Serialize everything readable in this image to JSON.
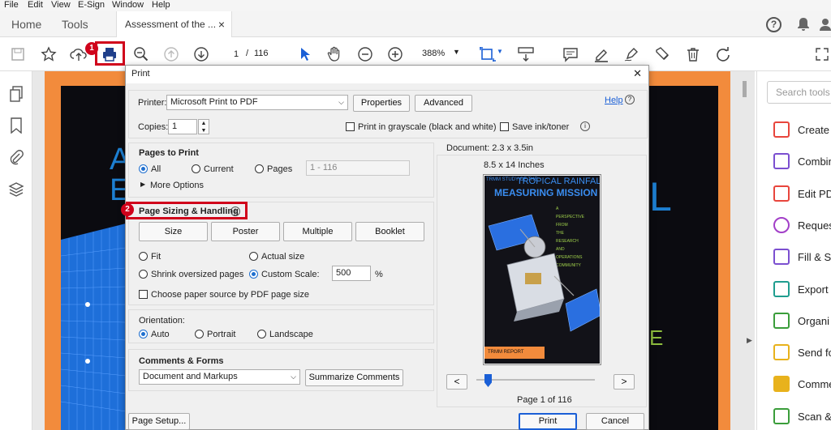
{
  "menubar": {
    "items": [
      "File",
      "Edit",
      "View",
      "E-Sign",
      "Window",
      "Help"
    ]
  },
  "tabs": {
    "home": "Home",
    "tools": "Tools",
    "doc": "Assessment of the ...",
    "close": "×"
  },
  "toolbar": {
    "page_current": "1",
    "page_sep": "/",
    "page_total": "116",
    "zoom": "388%"
  },
  "right_panel": {
    "search_placeholder": "Search tools",
    "items": [
      {
        "label": "Create",
        "color": "#e8453c"
      },
      {
        "label": "Combin",
        "color": "#7b4fd0"
      },
      {
        "label": "Edit PD",
        "color": "#e8453c"
      },
      {
        "label": "Reques",
        "color": "#a23fc8"
      },
      {
        "label": "Fill & S",
        "color": "#7b4fd0"
      },
      {
        "label": "Export",
        "color": "#1f9d8f"
      },
      {
        "label": "Organi",
        "color": "#3a9d3a"
      },
      {
        "label": "Send fo",
        "color": "#e8b21c"
      },
      {
        "label": "Comme",
        "color": "#e8b21c"
      },
      {
        "label": "Scan &",
        "color": "#3a9d3a"
      }
    ]
  },
  "page_bg_text": {
    "left_letters": "A\nE",
    "right_letter": "L",
    "right_letter2": "E"
  },
  "dialog": {
    "title": "Print",
    "close": "✕",
    "printer_label": "Printer:",
    "printer_value": "Microsoft Print to PDF",
    "properties": "Properties",
    "advanced": "Advanced",
    "help": "Help",
    "copies_label": "Copies:",
    "copies_value": "1",
    "grayscale": "Print in grayscale (black and white)",
    "save_ink": "Save ink/toner",
    "pages_to_print": "Pages to Print",
    "all": "All",
    "current": "Current",
    "pages": "Pages",
    "pages_range": "1 - 116",
    "more_options": "More Options",
    "page_sizing": "Page Sizing & Handling",
    "size": "Size",
    "poster": "Poster",
    "multiple": "Multiple",
    "booklet": "Booklet",
    "fit": "Fit",
    "actual_size": "Actual size",
    "shrink": "Shrink oversized pages",
    "custom_scale": "Custom Scale:",
    "scale_value": "500",
    "percent": "%",
    "paper_source": "Choose paper source by PDF page size",
    "orientation": "Orientation:",
    "auto": "Auto",
    "portrait": "Portrait",
    "landscape": "Landscape",
    "comments_forms": "Comments & Forms",
    "comments_value": "Document and Markups",
    "summarize": "Summarize Comments",
    "doc_size": "Document: 2.3 x 3.5in",
    "paper_size": "8.5 x 14 Inches",
    "prev": "<",
    "next": ">",
    "page_of": "Page 1 of 116",
    "page_setup": "Page Setup...",
    "print": "Print",
    "cancel": "Cancel"
  },
  "preview": {
    "title_small": "TRMM STUDY OF THE",
    "title_line1": "TROPICAL RAINFALL",
    "title_line2": "MEASURING MISSION",
    "side_text": [
      "A",
      "PERSPECTIVE",
      "FROM",
      "THE",
      "RESEARCH",
      "AND",
      "OPERATIONS",
      "COMMUNITY"
    ],
    "report": "TRMM REPORT"
  },
  "callouts": {
    "one": "1",
    "two": "2"
  }
}
